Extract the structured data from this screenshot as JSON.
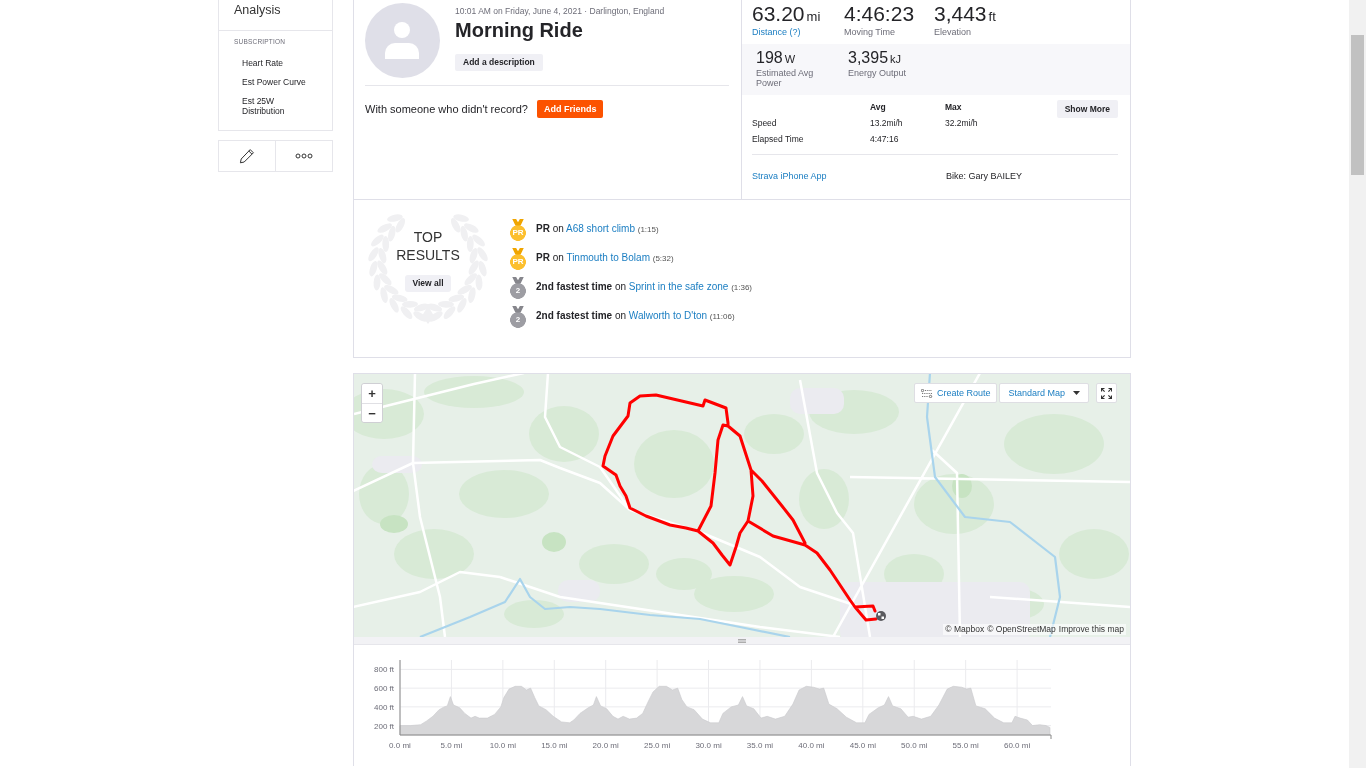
{
  "sidebar": {
    "items": [
      {
        "label": "Analysis"
      }
    ],
    "section": {
      "heading": "SUBSCRIPTION",
      "items": [
        {
          "label": "Heart Rate"
        },
        {
          "label": "Est Power Curve"
        },
        {
          "label": "Est 25W Distribution"
        }
      ]
    },
    "actions": [
      {
        "kind": "edit"
      },
      {
        "kind": "more"
      }
    ]
  },
  "activity": {
    "timestamp": "10:01 AM on Friday, June 4, 2021 · Darlington, England",
    "title": "Morning Ride",
    "description_button": "Add a description",
    "prompt": "With someone who didn't record?",
    "friends_button": "Add Friends"
  },
  "stats": {
    "primary": [
      {
        "value": "63.20",
        "unit": "mi",
        "label": "Distance (?)",
        "kind": "link"
      },
      {
        "value": "4:46:23",
        "label": "Moving Time",
        "kind": "plain"
      },
      {
        "value": "3,443",
        "unit": "ft",
        "label": "Elevation",
        "kind": "plain"
      }
    ],
    "secondary": [
      {
        "value": "198",
        "unit": "W",
        "label": "Estimated Avg Power"
      },
      {
        "value": "3,395",
        "unit": "kJ",
        "label": "Energy Output"
      }
    ],
    "table": {
      "columns": [
        "Avg",
        "Max"
      ],
      "rows": [
        {
          "label": "Speed",
          "cells": [
            "13.2mi/h",
            "32.2mi/h"
          ]
        },
        {
          "label": "Elapsed Time",
          "cells": [
            "4:47:16"
          ]
        }
      ]
    },
    "show_more": "Show More",
    "device": "Strava iPhone App",
    "bike": "Bike: Gary BAILEY"
  },
  "top_results": {
    "heading": "TOP RESULTS",
    "view_all": "View all",
    "items": [
      {
        "kind": "pr",
        "medal": "PR",
        "achievement": "PR",
        "joiner": "on",
        "segment": "A68 short climb",
        "time": "(1:15)"
      },
      {
        "kind": "pr",
        "medal": "PR",
        "achievement": "PR",
        "joiner": "on",
        "segment": "Tinmouth to Bolam",
        "time": "(5:32)"
      },
      {
        "kind": "silver",
        "medal": "2",
        "achievement": "2nd fastest time",
        "joiner": "on",
        "segment": "Sprint in the safe zone",
        "time": "(1:36)"
      },
      {
        "kind": "silver",
        "medal": "2",
        "achievement": "2nd fastest time",
        "joiner": "on",
        "segment": "Walworth to D'ton",
        "time": "(11:06)"
      }
    ]
  },
  "map": {
    "zoom_in": "+",
    "zoom_out": "−",
    "create_route": "Create Route",
    "map_style": "Standard Map",
    "attribution": [
      "© Mapbox",
      "© OpenStreetMap",
      "Improve this map"
    ]
  },
  "elevation": {
    "chart_data": {
      "type": "area",
      "grid": true,
      "x": [
        0,
        1,
        2,
        2.6,
        3.2,
        3.8,
        4.3,
        4.6,
        4.9,
        5.2,
        5.8,
        6.3,
        6.9,
        7.3,
        7.7,
        8.5,
        9.2,
        9.8,
        10.1,
        10.6,
        11.2,
        11.8,
        12.3,
        12.7,
        13.1,
        13.5,
        14.2,
        14.9,
        15.7,
        16.5,
        16.9,
        17.5,
        18.3,
        18.8,
        19.1,
        19.5,
        20.1,
        20.7,
        21.2,
        21.7,
        22.3,
        23,
        23.6,
        24.1,
        24.6,
        25.2,
        25.9,
        26.5,
        27,
        27.4,
        27.9,
        28.6,
        29.4,
        30.2,
        31,
        31.4,
        32.2,
        32.9,
        33.3,
        33.7,
        34.4,
        35.1,
        35.7,
        36.5,
        37.4,
        38.2,
        38.8,
        39.5,
        40.2,
        40.8,
        41.2,
        41.7,
        42.5,
        43.4,
        44.4,
        45.2,
        45.6,
        46.5,
        47.1,
        47.5,
        47.9,
        48.7,
        49.4,
        49.9,
        50.7,
        51.6,
        52.4,
        53.2,
        53.8,
        54.6,
        55.1,
        55.5,
        56,
        56.9,
        57.8,
        58.7,
        59.5,
        59.8,
        60.3,
        61,
        61.5,
        62.2,
        62.8,
        63.2
      ],
      "values": [
        200,
        200,
        210,
        250,
        300,
        370,
        400,
        410,
        510,
        420,
        390,
        330,
        280,
        300,
        280,
        280,
        320,
        400,
        500,
        590,
        620,
        620,
        580,
        600,
        500,
        410,
        370,
        300,
        240,
        230,
        260,
        330,
        390,
        420,
        510,
        410,
        380,
        300,
        270,
        300,
        270,
        280,
        330,
        450,
        560,
        620,
        620,
        580,
        600,
        480,
        400,
        370,
        270,
        230,
        230,
        330,
        400,
        420,
        510,
        410,
        380,
        280,
        300,
        270,
        300,
        430,
        580,
        620,
        610,
        590,
        600,
        430,
        380,
        290,
        230,
        230,
        320,
        390,
        420,
        510,
        410,
        380,
        290,
        300,
        270,
        300,
        420,
        590,
        620,
        610,
        590,
        600,
        410,
        380,
        280,
        230,
        230,
        300,
        280,
        260,
        200,
        210,
        200,
        180
      ],
      "xlim": [
        0,
        63.2
      ],
      "ylim": [
        100,
        900
      ],
      "xticks": [
        {
          "value": 0,
          "label": "0.0 mi"
        },
        {
          "value": 5,
          "label": "5.0 mi"
        },
        {
          "value": 10,
          "label": "10.0 mi"
        },
        {
          "value": 15,
          "label": "15.0 mi"
        },
        {
          "value": 20,
          "label": "20.0 mi"
        },
        {
          "value": 25,
          "label": "25.0 mi"
        },
        {
          "value": 30,
          "label": "30.0 mi"
        },
        {
          "value": 35,
          "label": "35.0 mi"
        },
        {
          "value": 40,
          "label": "40.0 mi"
        },
        {
          "value": 45,
          "label": "45.0 mi"
        },
        {
          "value": 50,
          "label": "50.0 mi"
        },
        {
          "value": 55,
          "label": "55.0 mi"
        },
        {
          "value": 60,
          "label": "60.0 mi"
        }
      ],
      "yticks": [
        {
          "value": 200,
          "label": "200 ft"
        },
        {
          "value": 400,
          "label": "400 ft"
        },
        {
          "value": 600,
          "label": "600 ft"
        },
        {
          "value": 800,
          "label": "800 ft"
        }
      ]
    }
  }
}
